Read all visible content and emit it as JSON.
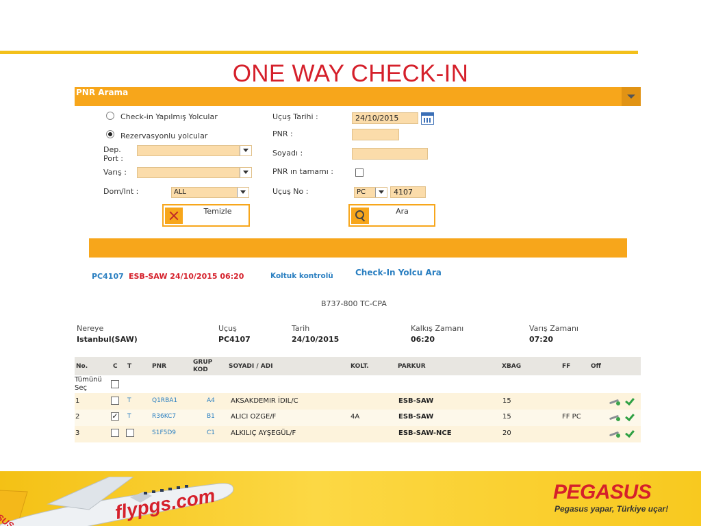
{
  "slide_title": "ONE WAY CHECK-IN",
  "panel": {
    "title": "PNR Arama"
  },
  "form": {
    "radio_checked_in": "Check-in Yapılmış Yolcular",
    "radio_reservations": "Rezervasyonlu yolcular",
    "dep_port_label_1": "Dep.",
    "dep_port_label_2": "Port :",
    "arrival_label": "Varış :",
    "dom_int_label": "Dom/Int :",
    "dom_int_value": "ALL",
    "flight_date_label": "Uçuş Tarihi :",
    "flight_date_value": "24/10/2015",
    "pnr_label": "PNR :",
    "surname_label": "Soyadı :",
    "pnr_full_label": "PNR ın tamamı :",
    "flight_no_label": "Uçuş No :",
    "carrier_value": "PC",
    "flight_no_value": "4107",
    "clear_button": "Temizle",
    "search_button": "Ara"
  },
  "flight_line": {
    "flight_code": "PC4107",
    "route_datetime": "ESB-SAW 24/10/2015 06:20",
    "seat_check": "Koltuk kontrolü",
    "search_passenger": "Check-In Yolcu Ara"
  },
  "aircraft": "B737-800 TC-CPA",
  "info": {
    "dest_label": "Nereye",
    "dest_value": "Istanbul(SAW)",
    "flight_label": "Uçuş",
    "flight_value": "PC4107",
    "date_label": "Tarih",
    "date_value": "24/10/2015",
    "dep_time_label": "Kalkış Zamanı",
    "dep_time_value": "06:20",
    "arr_time_label": "Varış Zamanı",
    "arr_time_value": "07:20"
  },
  "table": {
    "headers": {
      "no": "No.",
      "c": "C",
      "t": "T",
      "pnr": "PNR",
      "group_1": "GRUP",
      "group_2": "KOD",
      "name": "SOYADI / ADI",
      "seat": "KOLT.",
      "route": "PARKUR",
      "xbag": "XBAG",
      "ff": "FF",
      "off": "Off"
    },
    "select_all_1": "Tümünü",
    "select_all_2": "Seç",
    "rows": [
      {
        "no": "1",
        "t": "T",
        "pnr": "Q1RBA1",
        "group": "A4",
        "name": "AKSAKDEMIR İDIL/C",
        "seat": "",
        "route": "ESB-SAW",
        "xbag": "15",
        "ff": ""
      },
      {
        "no": "2",
        "t": "T",
        "pnr": "R36KC7",
        "group": "B1",
        "name": "ALICI OZGE/F",
        "seat": "4A",
        "route": "ESB-SAW",
        "xbag": "15",
        "ff": "FF PC"
      },
      {
        "no": "3",
        "t": "",
        "pnr": "S1F5D9",
        "group": "C1",
        "name": "ALKILIÇ AYŞEGÜL/F",
        "seat": "",
        "route": "ESB-SAW-NCE",
        "xbag": "20",
        "ff": ""
      }
    ]
  },
  "footer": {
    "plane_text": "flypgs.com",
    "tail_text": "PEGASUS",
    "brand": "PEGASUS",
    "slogan": "Pegasus yapar, Türkiye uçar!"
  },
  "colors": {
    "accent_orange": "#f7a61b",
    "brand_red": "#d5202b",
    "link_blue": "#2a7fc1",
    "footer_yellow": "#f8c91f"
  }
}
